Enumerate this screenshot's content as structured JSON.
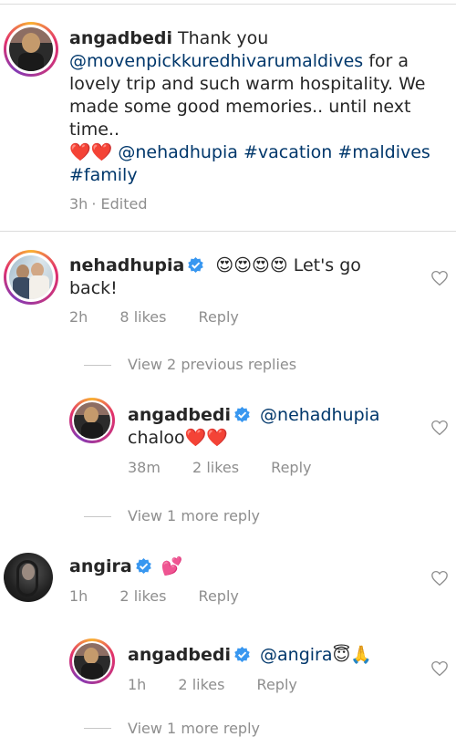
{
  "caption": {
    "username": "angadbedi",
    "text_1": "Thank you",
    "mention_1": "@movenpickkuredhivarumaldives",
    "text_2": "for a",
    "text_3": "lovely trip and such warm hospitality. We",
    "text_4": "made some good memories.. until next",
    "text_5": "time..",
    "hearts": "❤️❤️",
    "mention_2": "@nehadhupia",
    "hashtag_1": "#vacation",
    "hashtag_2": "#maldives",
    "hashtag_3": "#family",
    "time": "3h",
    "edited": "· Edited"
  },
  "comments": [
    {
      "username": "nehadhupia",
      "verified": true,
      "emojis": "😍😍😍😍",
      "text_1": "Let's go",
      "text_2": "back!",
      "time": "2h",
      "likes": "8 likes",
      "reply": "Reply"
    }
  ],
  "view_prev": "View 2 previous replies",
  "reply_1": {
    "username": "angadbedi",
    "mention": "@nehadhupia",
    "text": "chaloo",
    "hearts": "❤️❤️",
    "time": "38m",
    "likes": "2 likes",
    "reply": "Reply"
  },
  "view_more_1": "View 1 more reply",
  "comment_2": {
    "username": "angira",
    "emoji": "💕",
    "time": "1h",
    "likes": "2 likes",
    "reply": "Reply"
  },
  "reply_2": {
    "username": "angadbedi",
    "mention": "@angira",
    "emoji": "😇🙏",
    "time": "1h",
    "likes": "2 likes",
    "reply": "Reply"
  },
  "view_more_2": "View 1 more reply",
  "colors": {
    "link": "#00376b",
    "meta": "#8e8e8e",
    "verified": "#3897f0",
    "heart": "#e0245e"
  }
}
